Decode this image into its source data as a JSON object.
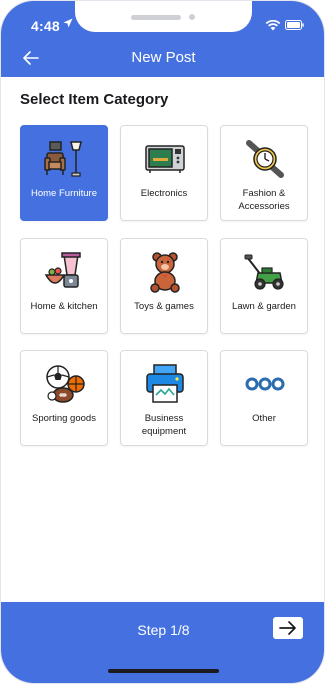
{
  "status_bar": {
    "time": "4:48"
  },
  "header": {
    "title": "New Post"
  },
  "main": {
    "section_title": "Select Item Category",
    "categories": [
      {
        "label": "Home Furniture",
        "icon": "furniture-icon",
        "selected": true
      },
      {
        "label": "Electronics",
        "icon": "microwave-icon",
        "selected": false
      },
      {
        "label": "Fashion & Accessories",
        "icon": "watch-icon",
        "selected": false
      },
      {
        "label": "Home & kitchen",
        "icon": "blender-icon",
        "selected": false
      },
      {
        "label": "Toys & games",
        "icon": "teddy-bear-icon",
        "selected": false
      },
      {
        "label": "Lawn & garden",
        "icon": "lawn-mower-icon",
        "selected": false
      },
      {
        "label": "Sporting goods",
        "icon": "sports-balls-icon",
        "selected": false
      },
      {
        "label": "Business equipment",
        "icon": "printer-icon",
        "selected": false
      },
      {
        "label": "Other",
        "icon": "more-dots-icon",
        "selected": false
      }
    ]
  },
  "footer": {
    "step_label": "Step 1/8"
  },
  "colors": {
    "accent": "#4570e0",
    "text": "#1b1b1f",
    "tile_border": "#dadada"
  }
}
